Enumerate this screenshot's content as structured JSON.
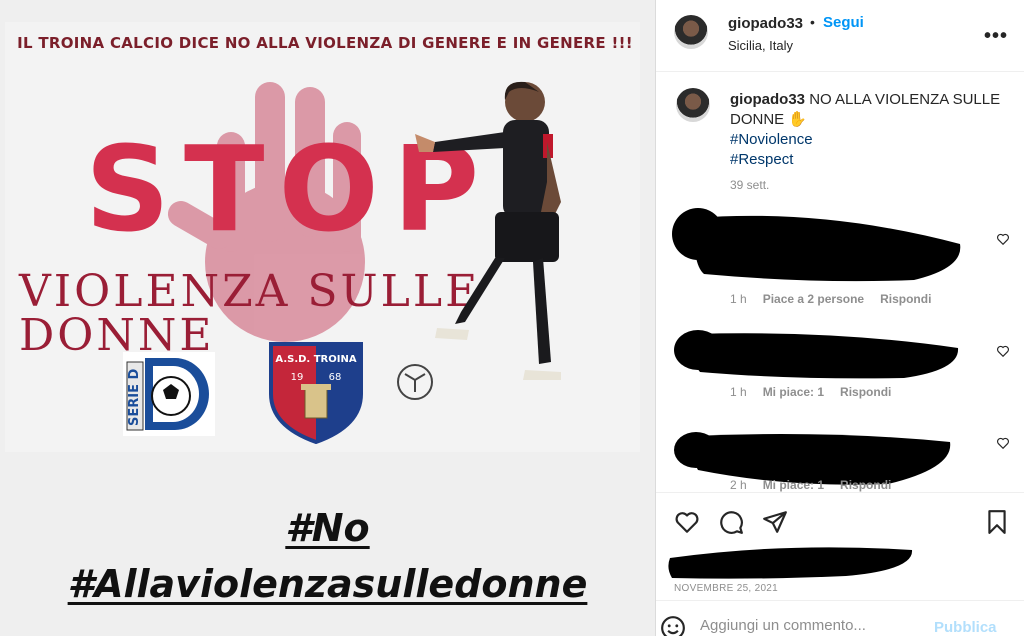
{
  "post_image": {
    "headline": "IL TROINA CALCIO DICE NO ALLA VIOLENZA DI GENERE E IN GENERE !!!",
    "stop_word": "STOP",
    "violenza_word": "VIOLENZA SULLE DONNE",
    "seried_logo_text": "SERIE D",
    "troina_crest": {
      "line1": "A.S.D. TROINA",
      "year_left": "19",
      "year_right": "68"
    },
    "hashtags": [
      "#No",
      "#Allaviolenzasulledonne"
    ]
  },
  "header": {
    "username": "giopado33",
    "dot": "•",
    "follow_label": "Segui",
    "location": "Sicilia, Italy",
    "more_icon": "more-horizontal-icon"
  },
  "caption": {
    "username": "giopado33",
    "text": "NO ALLA VIOLENZA SULLE DONNE",
    "emoji": "✋",
    "hashtags": [
      "#Noviolence",
      "#Respect"
    ],
    "time": "39 sett."
  },
  "comments": [
    {
      "time": "1 h",
      "likes": "Piace a 2 persone",
      "reply": "Rispondi"
    },
    {
      "time": "1 h",
      "likes": "Mi piace: 1",
      "reply": "Rispondi"
    },
    {
      "time": "2 h",
      "likes": "Mi piace: 1",
      "reply": "Rispondi"
    }
  ],
  "actions": {
    "icons": [
      "heart-icon",
      "comment-icon",
      "share-icon",
      "bookmark-icon"
    ]
  },
  "post_date": "NOVEMBRE 25, 2021",
  "comment_box": {
    "placeholder": "Aggiungi un commento...",
    "publish_label": "Pubblica"
  },
  "colors": {
    "link": "#0095f6",
    "hashtag": "#00376b",
    "stop": "#d4314f",
    "muted": "#8e8e8e"
  }
}
